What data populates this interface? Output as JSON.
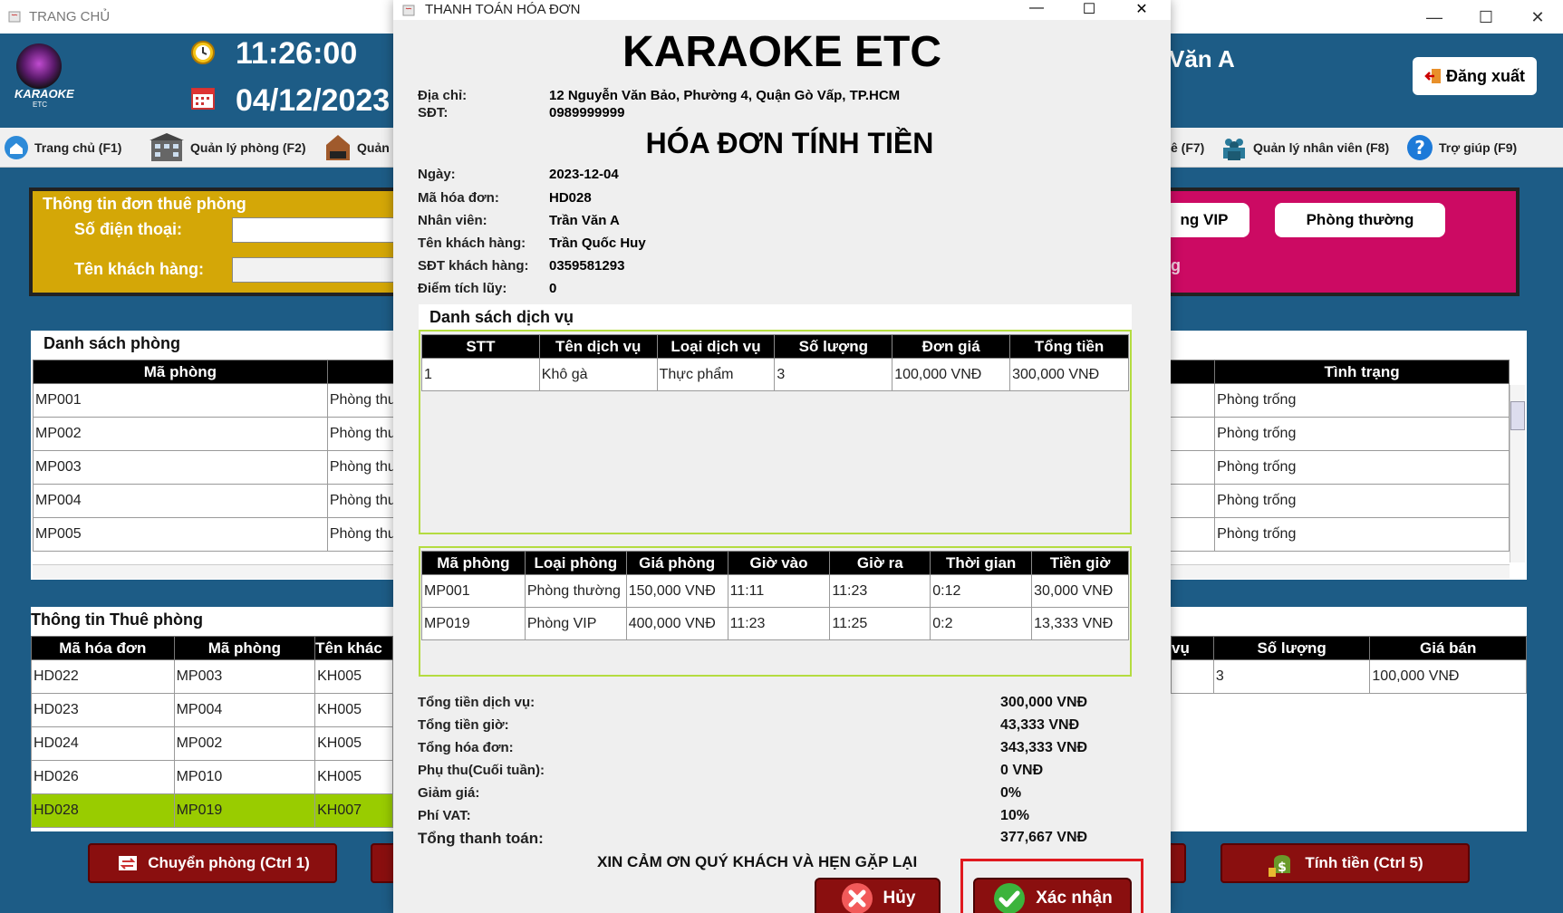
{
  "app": {
    "title": "TRANG CHỦ",
    "time": "11:26:00",
    "date": "04/12/2023",
    "user_partial": "Văn A",
    "logout": "Đăng xuất",
    "logo_text": "KARAOKE",
    "logo_sub": "ETC"
  },
  "menu": [
    {
      "label": "Trang chủ (F1)"
    },
    {
      "label": "Quản lý phòng (F2)"
    },
    {
      "label": "Quản"
    },
    {
      "label": "ê (F7)"
    },
    {
      "label": "Quản lý nhân viên (F8)"
    },
    {
      "label": "Trợ giúp (F9)"
    }
  ],
  "rent_form": {
    "title": "Thông tin đơn thuê phòng",
    "phone_label": "Số điện thoại:",
    "customer_label": "Tên khách hàng:"
  },
  "room_filter": {
    "vip": "ng VIP",
    "normal": "Phòng thường",
    "partial": "ng"
  },
  "room_list": {
    "title": "Danh sách phòng",
    "col_code": "Mã phòng",
    "col_status": "Tình trạng",
    "rows": [
      {
        "code": "MP001",
        "type": "Phòng thư",
        "status": "Phòng trống"
      },
      {
        "code": "MP002",
        "type": "Phòng thư",
        "status": "Phòng trống"
      },
      {
        "code": "MP003",
        "type": "Phòng thư",
        "status": "Phòng trống"
      },
      {
        "code": "MP004",
        "type": "Phòng thư",
        "status": "Phòng trống"
      },
      {
        "code": "MP005",
        "type": "Phòng thư",
        "status": "Phòng trống"
      }
    ]
  },
  "rental_info": {
    "title": "Thông tin Thuê phòng",
    "col_invoice": "Mã hóa đơn",
    "col_room": "Mã phòng",
    "col_customer": "Tên khác",
    "rows": [
      {
        "invoice": "HD022",
        "room": "MP003",
        "customer": "KH005"
      },
      {
        "invoice": "HD023",
        "room": "MP004",
        "customer": "KH005"
      },
      {
        "invoice": "HD024",
        "room": "MP002",
        "customer": "KH005"
      },
      {
        "invoice": "HD026",
        "room": "MP010",
        "customer": "KH005"
      },
      {
        "invoice": "HD028",
        "room": "MP019",
        "customer": "KH007"
      }
    ],
    "selected_index": 4
  },
  "service_side": {
    "col_partial": "vụ",
    "col_qty": "Số lượng",
    "col_price": "Giá bán",
    "row": {
      "qty": "3",
      "price": "100,000 VNĐ"
    }
  },
  "bottom_buttons": {
    "transfer": "Chuyển phòng (Ctrl 1)",
    "checkout": "Tính tiền (Ctrl 5)"
  },
  "dialog": {
    "title": "THANH TOÁN HÓA ĐƠN",
    "store_name": "KARAOKE ETC",
    "address_label": "Địa chỉ:",
    "address": "12 Nguyễn Văn Bảo, Phường 4, Quận Gò Vấp, TP.HCM",
    "phone_label": "SĐT:",
    "phone": "0989999999",
    "heading": "HÓA ĐƠN TÍNH TIỀN",
    "info": [
      {
        "label": "Ngày:",
        "value": "2023-12-04"
      },
      {
        "label": "Mã hóa đơn:",
        "value": "HD028"
      },
      {
        "label": "Nhân viên:",
        "value": "Trần Văn A"
      },
      {
        "label": "Tên khách hàng:",
        "value": "Trần Quốc Huy"
      },
      {
        "label": "SĐT khách hàng:",
        "value": "0359581293"
      },
      {
        "label": "Điểm tích lũy:",
        "value": "0"
      }
    ],
    "services_title": "Danh sách dịch vụ",
    "service_headers": [
      "STT",
      "Tên dịch vụ",
      "Loại dịch vụ",
      "Số lượng",
      "Đơn giá",
      "Tổng tiền"
    ],
    "services": [
      [
        "1",
        "Khô gà",
        "Thực phẩm",
        "3",
        "100,000 VNĐ",
        "300,000 VNĐ"
      ]
    ],
    "room_headers": [
      "Mã phòng",
      "Loại phòng",
      "Giá phòng",
      "Giờ vào",
      "Giờ ra",
      "Thời gian",
      "Tiền giờ"
    ],
    "rooms": [
      [
        "MP001",
        "Phòng thường",
        "150,000 VNĐ",
        "11:11",
        "11:23",
        "0:12",
        "30,000 VNĐ"
      ],
      [
        "MP019",
        "Phòng VIP",
        "400,000 VNĐ",
        "11:23",
        "11:25",
        "0:2",
        "13,333 VNĐ"
      ]
    ],
    "totals": [
      {
        "label": "Tổng tiền dịch vụ:",
        "value": "300,000 VNĐ"
      },
      {
        "label": "Tổng tiền giờ:",
        "value": "43,333 VNĐ"
      },
      {
        "label": "Tổng hóa đơn:",
        "value": "343,333 VNĐ"
      },
      {
        "label": "Phụ thu(Cuối tuần):",
        "value": "0 VNĐ"
      },
      {
        "label": "Giảm giá:",
        "value": "0%"
      },
      {
        "label": "Phí VAT:",
        "value": "10%"
      },
      {
        "label": "Tổng thanh toán:",
        "value": "377,667 VNĐ"
      }
    ],
    "thanks": "XIN CẢM ƠN QUÝ KHÁCH VÀ HẸN GẶP LẠI",
    "cancel": "Hủy",
    "confirm": "Xác nhận"
  },
  "colors": {
    "header_bg": "#1d5c86",
    "yellow_panel": "#d4a707",
    "pink_panel": "#cc0a63",
    "selected_row": "#99cc00",
    "button_red": "#8a0f0f",
    "highlight": "#e0191f"
  }
}
